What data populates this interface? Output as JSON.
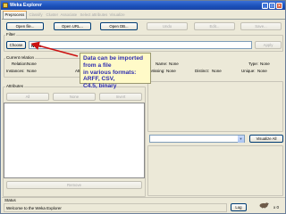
{
  "window": {
    "title": "Weka Explorer",
    "controls": {
      "minimize": "_",
      "maximize": "□",
      "close": "×"
    }
  },
  "tabs": [
    {
      "label": "Preprocess",
      "active": true
    },
    {
      "label": "Classify",
      "active": false
    },
    {
      "label": "Cluster",
      "active": false
    },
    {
      "label": "Associate",
      "active": false
    },
    {
      "label": "Select attributes",
      "active": false
    },
    {
      "label": "Visualize",
      "active": false
    }
  ],
  "toolbar": {
    "open_file": "Open file...",
    "open_url": "Open URL...",
    "open_db": "Open DB...",
    "undo": "Undo",
    "edit": "Edit...",
    "save": "Save..."
  },
  "filter": {
    "group_title": "Filter",
    "choose_label": "Choose",
    "value": "None",
    "apply_label": "Apply"
  },
  "current_relation": {
    "group_title": "Current relation",
    "relation_label": "Relation:",
    "relation_value": "None",
    "instances_label": "Instances:",
    "instances_value": "None",
    "attributes_label": "Attributes:",
    "attributes_value": "None"
  },
  "selected_attribute": {
    "name_label": "Name:",
    "name_value": "None",
    "type_label": "Type:",
    "type_value": "None",
    "missing_label": "Missing:",
    "missing_value": "None",
    "distinct_label": "Distinct:",
    "distinct_value": "None",
    "unique_label": "Unique:",
    "unique_value": "None"
  },
  "attributes": {
    "group_title": "Attributes",
    "all_label": "All",
    "none_label": "None",
    "invert_label": "Invert",
    "remove_label": "Remove"
  },
  "visualize_all_label": "Visualize All",
  "status": {
    "group_title": "Status",
    "message": "Welcome to the Weka Explorer",
    "log_label": "Log",
    "count": "x 0"
  },
  "callout": {
    "lines": [
      "Data can be imported from a file",
      "in various formats: ARFF, CSV,",
      "C4.5, binary"
    ]
  },
  "colors": {
    "titlebar": "#1a4fb8",
    "callout_bg": "#fffac8",
    "callout_text": "#2d2db0",
    "arrow": "#cc1111",
    "panel_bg": "#ece9d8"
  }
}
